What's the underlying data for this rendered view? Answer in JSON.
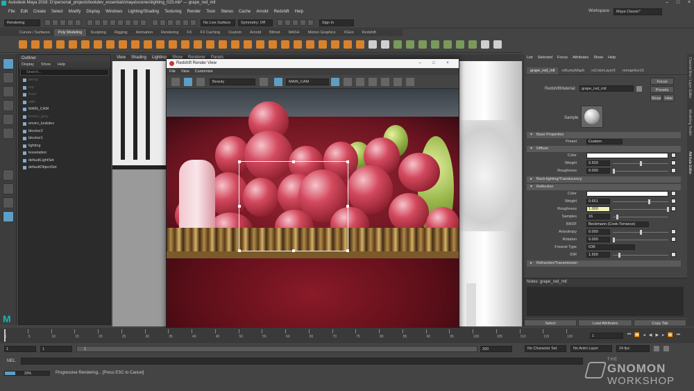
{
  "window": {
    "title": "Autodesk Maya 2018: D:\\personal_projects\\lookdev_essentials\\maya\\scenes\\lighting_023.mb*   ---   grape_red_mtl",
    "workspace_label": "Workspace :",
    "workspace_value": "Maya Classic*"
  },
  "menubar": [
    "File",
    "Edit",
    "Create",
    "Select",
    "Modify",
    "Display",
    "Windows",
    "Lighting/Shading",
    "Texturing",
    "Render",
    "Toon",
    "Stereo",
    "Cache",
    "Arnold",
    "Redshift",
    "Help"
  ],
  "statusline": {
    "menuset": "Rendering",
    "live_surface": "No Live Surface",
    "symmetry": "Symmetry: Off",
    "sign_in": "Sign In"
  },
  "shelf_tabs": [
    "Curves / Surfaces",
    "Poly Modeling",
    "Sculpting",
    "Rigging",
    "Animation",
    "Rendering",
    "FX",
    "FX Caching",
    "Custom",
    "Arnold",
    "Bifrost",
    "MASH",
    "Motion Graphics",
    "XGen",
    "Redshift"
  ],
  "shelf_active": "Poly Modeling",
  "outliner": {
    "title": "Outliner",
    "menus": [
      "Display",
      "Show",
      "Help"
    ],
    "search_placeholder": "Search...",
    "items": [
      {
        "label": "persp",
        "dim": true
      },
      {
        "label": "top",
        "dim": true
      },
      {
        "label": "front",
        "dim": true
      },
      {
        "label": "side",
        "dim": true
      },
      {
        "label": "MAIN_CAM",
        "dim": false
      },
      {
        "label": "enviro_grey",
        "dim": true
      },
      {
        "label": "enviro_lookdev",
        "dim": false
      },
      {
        "label": "blocker2",
        "dim": false
      },
      {
        "label": "blocker1",
        "dim": false
      },
      {
        "label": "lighting",
        "dim": false
      },
      {
        "label": "tesselation",
        "dim": false
      },
      {
        "label": "defaultLightSet",
        "dim": false
      },
      {
        "label": "defaultObjectSet",
        "dim": false
      }
    ]
  },
  "viewport": {
    "menus": [
      "View",
      "Shading",
      "Lighting",
      "Show",
      "Renderer",
      "Panels"
    ]
  },
  "render_view": {
    "title": "Redshift Render View",
    "menus": [
      "File",
      "View",
      "Customize"
    ],
    "aov": "Beauty",
    "camera": "MAIN_CAM"
  },
  "attribute_editor": {
    "menus": [
      "List",
      "Selected",
      "Focus",
      "Attributes",
      "Show",
      "Help"
    ],
    "tabs": [
      "grape_red_mtl",
      "rsBumpMap6",
      "rsColorLayer5",
      "remapHsv16"
    ],
    "material_label": "RedshiftMaterial:",
    "material_name": "grape_red_mtl",
    "buttons": {
      "focus": "Focus",
      "presets": "Presets",
      "show": "Show",
      "hide": "Hide"
    },
    "sample_label": "Sample",
    "base_properties": "Base Properties",
    "preset_label": "Preset",
    "preset_value": "Custom",
    "diffuse": {
      "title": "Diffuse",
      "color_label": "Color",
      "weight_label": "Weight",
      "weight": "0.500",
      "weight_level": 0.5,
      "roughness_label": "Roughness",
      "roughness": "0.000",
      "roughness_level": 0
    },
    "backlighting": "Back-lighting/Translucency",
    "reflection": {
      "title": "Reflection",
      "color_label": "Color",
      "weight_label": "Weight",
      "weight": "0.651",
      "weight_level": 0.651,
      "roughness_label": "Roughness",
      "roughness": "1.000",
      "roughness_level": 1.0,
      "samples_label": "Samples",
      "samples": "16",
      "samples_level": 0.0625,
      "brdf_label": "BRDF",
      "brdf": "Beckmann (Cook-Torrance)",
      "anisotropy_label": "Anisotropy",
      "anisotropy": "0.000",
      "anisotropy_level": 0.5,
      "rotation_label": "Rotation",
      "rotation": "0.000",
      "rotation_level": 0,
      "fresnel_label": "Fresnel Type",
      "fresnel": "IOR",
      "ior_label": "IOR",
      "ior": "1.500",
      "ior_level": 0.1
    },
    "refraction": "Refraction/Transmission",
    "notes": "Notes: grape_red_mtl",
    "bottom_buttons": [
      "Select",
      "Load Attributes",
      "Copy Tab"
    ]
  },
  "side_strip": [
    "Channel Box / Layer Editor",
    "Modelling Toolkit",
    "Attribute Editor"
  ],
  "time_slider": {
    "ticks": [
      "1",
      "5",
      "10",
      "15",
      "20",
      "25",
      "30",
      "35",
      "40",
      "45",
      "50",
      "55",
      "60",
      "65",
      "70",
      "75",
      "80",
      "85",
      "90",
      "95",
      "100",
      "105",
      "110",
      "115",
      "120"
    ],
    "current_frame": "1"
  },
  "range_slider": {
    "start": "1",
    "start2": "1",
    "range_label": "1",
    "end2": "200",
    "character_set": "No Character Set",
    "anim_layer": "No Anim Layer",
    "fps": "24 fps"
  },
  "command_line": {
    "label": "MEL"
  },
  "help_line": {
    "progress": "23%",
    "progress_level": 0.23,
    "message": "Progressive Rendering... [Press ESC to Cancel]"
  },
  "watermark": {
    "the": "THE",
    "gnomon": "GNOMON",
    "workshop": "WORKSHOP"
  },
  "colors": {
    "accent": "#5d9ec6",
    "highlight_field": "#f2f2b4",
    "maya_logo": "#1ab3b6"
  }
}
